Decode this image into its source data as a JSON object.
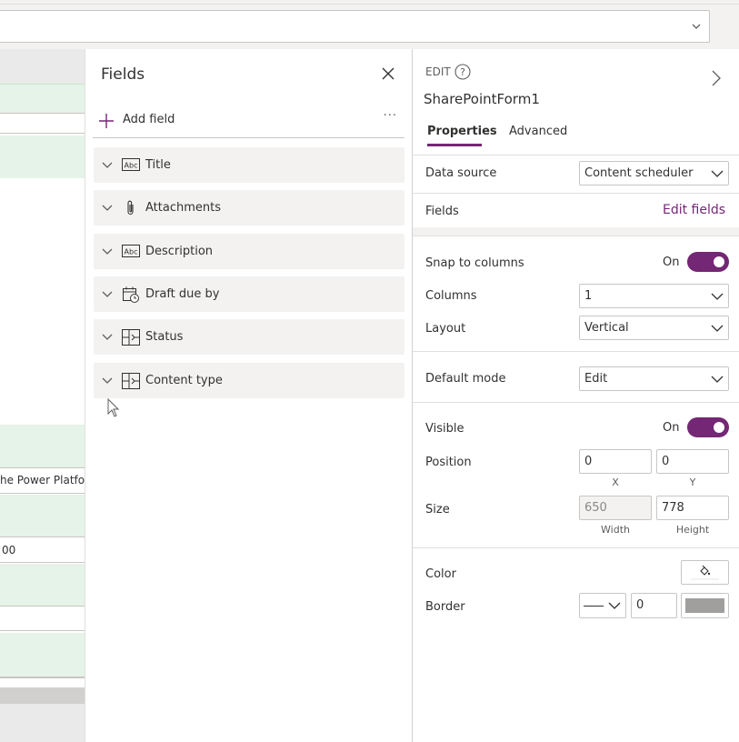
{
  "canvas": {
    "row_text_1": "he Power Platforn",
    "row_text_2": "00"
  },
  "fields_panel": {
    "title": "Fields",
    "add_field_label": "Add field",
    "more_label": "···",
    "items": [
      {
        "label": "Title",
        "icon": "text-field-icon"
      },
      {
        "label": "Attachments",
        "icon": "paperclip-icon"
      },
      {
        "label": "Description",
        "icon": "text-field-icon"
      },
      {
        "label": "Draft due by",
        "icon": "calendar-clock-icon"
      },
      {
        "label": "Status",
        "icon": "choice-field-icon"
      },
      {
        "label": "Content type",
        "icon": "choice-field-icon"
      }
    ]
  },
  "properties": {
    "edit_label": "EDIT",
    "form_name": "SharePointForm1",
    "tabs": [
      "Properties",
      "Advanced"
    ],
    "active_tab": "Properties",
    "data_source_label": "Data source",
    "data_source_value": "Content scheduler",
    "fields_label": "Fields",
    "edit_fields_link": "Edit fields",
    "snap_label": "Snap to columns",
    "snap_state": "On",
    "columns_label": "Columns",
    "columns_value": "1",
    "layout_label": "Layout",
    "layout_value": "Vertical",
    "default_mode_label": "Default mode",
    "default_mode_value": "Edit",
    "visible_label": "Visible",
    "visible_state": "On",
    "position_label": "Position",
    "position_x": "0",
    "position_y": "0",
    "x_label": "X",
    "y_label": "Y",
    "size_label": "Size",
    "size_width": "650",
    "size_height": "778",
    "width_label": "Width",
    "height_label": "Height",
    "color_label": "Color",
    "border_label": "Border",
    "border_width": "0",
    "accent_color": "#742774"
  }
}
